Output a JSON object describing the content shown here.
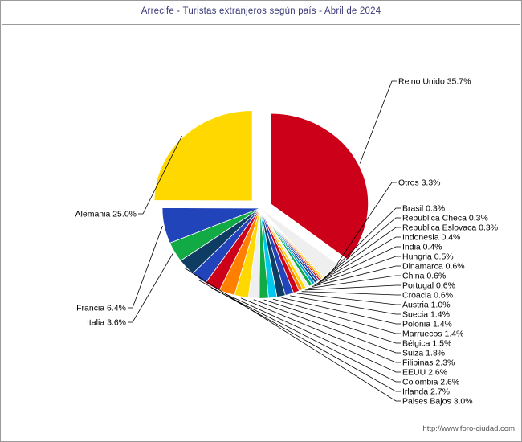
{
  "title": "Arrecife - Turistas extranjeros según país  -  Abril de 2024",
  "footer": "http://www.foro-ciudad.com",
  "chart_data": {
    "type": "pie",
    "title": "Arrecife - Turistas extranjeros según país  -  Abril de 2024",
    "legend": "labels-with-leader-lines",
    "unit": "percent",
    "labels": [
      "Reino Unido 35.7%",
      "Otros 3.3%",
      "Brasil 0.3%",
      "Republica Checa 0.3%",
      "Republica Eslovaca 0.3%",
      "Indonesia 0.4%",
      "India 0.4%",
      "Hungria 0.5%",
      "Dinamarca 0.6%",
      "China 0.6%",
      "Portugal 0.6%",
      "Croacia 0.6%",
      "Austria 1.0%",
      "Suecia 1.4%",
      "Polonia 1.4%",
      "Marruecos 1.4%",
      "Bélgica 1.5%",
      "Suiza 1.8%",
      "Filipinas 2.3%",
      "EEUU 2.6%",
      "Colombia 2.6%",
      "Irlanda 2.7%",
      "Paises Bajos 3.0%",
      "Italia 3.6%",
      "Francia 6.4%",
      "Alemania 25.0%"
    ],
    "categories": [
      "Reino Unido",
      "Otros",
      "Brasil",
      "Republica Checa",
      "Republica Eslovaca",
      "Indonesia",
      "India",
      "Hungria",
      "Dinamarca",
      "China",
      "Portugal",
      "Croacia",
      "Austria",
      "Suecia",
      "Polonia",
      "Marruecos",
      "Bélgica",
      "Suiza",
      "Filipinas",
      "EEUU",
      "Colombia",
      "Irlanda",
      "Paises Bajos",
      "Italia",
      "Francia",
      "Alemania"
    ],
    "values": [
      35.7,
      3.3,
      0.3,
      0.3,
      0.3,
      0.4,
      0.4,
      0.5,
      0.6,
      0.6,
      0.6,
      0.6,
      1.0,
      1.4,
      1.4,
      1.4,
      1.5,
      1.8,
      2.3,
      2.6,
      2.6,
      2.7,
      3.0,
      3.6,
      6.4,
      25.0
    ],
    "colors": [
      "#CC0019",
      "#EFEFEF",
      "#FFD800",
      "#FF7F00",
      "#CC0019",
      "#2244BB",
      "#0E3C63",
      "#00A0DC",
      "#11AA44",
      "#EFEFEF",
      "#FFD800",
      "#FF7F00",
      "#CC0019",
      "#2244BB",
      "#0E3C63",
      "#00C8F0",
      "#11AA44",
      "#EFEFEF",
      "#FFD800",
      "#FF7F00",
      "#CC0019",
      "#2244BB",
      "#0E3C63",
      "#11AA44",
      "#2244BB",
      "#FFD800"
    ],
    "exploded": [
      "Reino Unido",
      "Alemania"
    ]
  }
}
